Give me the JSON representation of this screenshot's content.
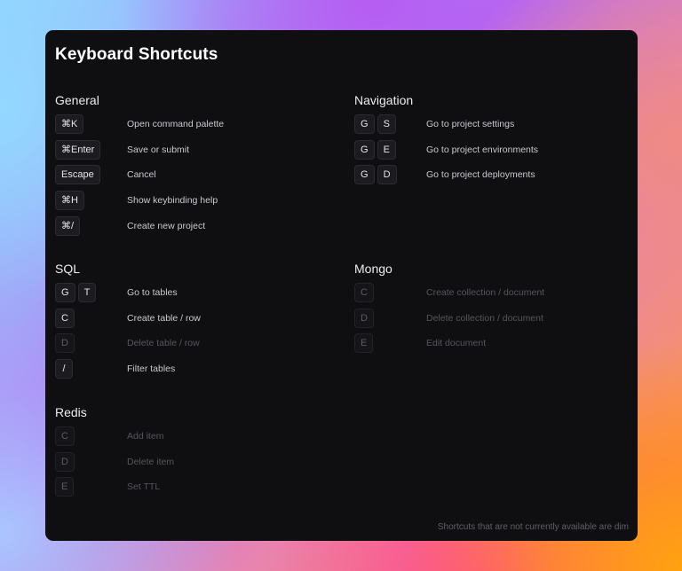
{
  "dialog": {
    "title": "Keyboard Shortcuts",
    "footer": "Shortcuts that are not currently available are dim"
  },
  "sections": {
    "general": {
      "title": "General",
      "items": [
        {
          "keys": [
            "⌘K"
          ],
          "label": "Open command palette",
          "dim": false
        },
        {
          "keys": [
            "⌘Enter"
          ],
          "label": "Save or submit",
          "dim": false
        },
        {
          "keys": [
            "Escape"
          ],
          "label": "Cancel",
          "dim": false
        },
        {
          "keys": [
            "⌘H"
          ],
          "label": "Show keybinding help",
          "dim": false
        },
        {
          "keys": [
            "⌘/"
          ],
          "label": "Create new project",
          "dim": false
        }
      ]
    },
    "navigation": {
      "title": "Navigation",
      "items": [
        {
          "keys": [
            "G",
            "S"
          ],
          "label": "Go to project settings",
          "dim": false
        },
        {
          "keys": [
            "G",
            "E"
          ],
          "label": "Go to project environments",
          "dim": false
        },
        {
          "keys": [
            "G",
            "D"
          ],
          "label": "Go to project deployments",
          "dim": false
        }
      ]
    },
    "sql": {
      "title": "SQL",
      "items": [
        {
          "keys": [
            "G",
            "T"
          ],
          "label": "Go to tables",
          "dim": false
        },
        {
          "keys": [
            "C"
          ],
          "label": "Create table / row",
          "dim": false
        },
        {
          "keys": [
            "D"
          ],
          "label": "Delete table / row",
          "dim": true
        },
        {
          "keys": [
            "/"
          ],
          "label": "Filter tables",
          "dim": false
        }
      ]
    },
    "mongo": {
      "title": "Mongo",
      "items": [
        {
          "keys": [
            "C"
          ],
          "label": "Create collection / document",
          "dim": true
        },
        {
          "keys": [
            "D"
          ],
          "label": "Delete collection / document",
          "dim": true
        },
        {
          "keys": [
            "E"
          ],
          "label": "Edit document",
          "dim": true
        }
      ]
    },
    "redis": {
      "title": "Redis",
      "items": [
        {
          "keys": [
            "C"
          ],
          "label": "Add item",
          "dim": true
        },
        {
          "keys": [
            "D"
          ],
          "label": "Delete item",
          "dim": true
        },
        {
          "keys": [
            "E"
          ],
          "label": "Set TTL",
          "dim": true
        }
      ]
    }
  }
}
